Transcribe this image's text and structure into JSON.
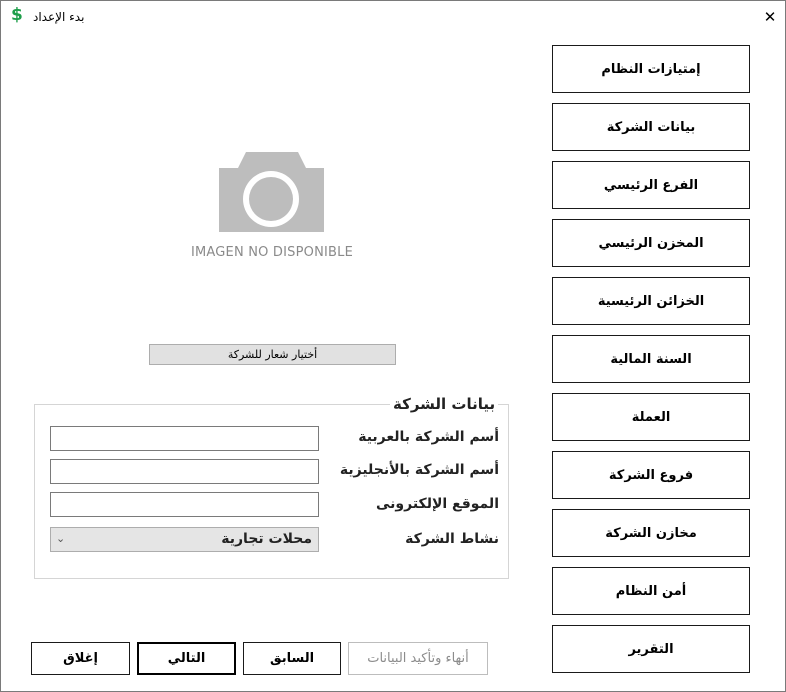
{
  "window": {
    "title": "بدء الإعداد",
    "app_icon": "$",
    "close_glyph": "✕"
  },
  "nav": [
    "إمتيازات النظام",
    "بيانات الشركة",
    "الفرع الرئيسي",
    "المخزن الرئيسي",
    "الخزائن الرئيسية",
    "السنة المالية",
    "العملة",
    "فروع الشركة",
    "مخازن الشركة",
    "أمن النظام",
    "التقرير"
  ],
  "logo": {
    "placeholder_text": "IMAGEN NO DISPONIBLE",
    "choose_button": "أختيار شعار للشركة"
  },
  "company_group": {
    "title": "بيانات الشركة",
    "name_ar_label": "أسم الشركة بالعربية",
    "name_ar_value": "",
    "name_en_label": "أسم الشركة بالأنجليزية",
    "name_en_value": "",
    "website_label": "الموقع الإلكترونى",
    "website_value": "",
    "activity_label": "نشاط الشركة",
    "activity_value": "محلات تجارية"
  },
  "footer": {
    "finish_button": "أنهاء وتأكيد البيانات",
    "previous_button": "السابق",
    "next_button": "التالي",
    "close_button": "إغلاق"
  },
  "colors": {
    "app_icon": "#1e9e4a",
    "photo_icon": "#bdbdbd",
    "disabled_text": "#8c8c8c"
  }
}
